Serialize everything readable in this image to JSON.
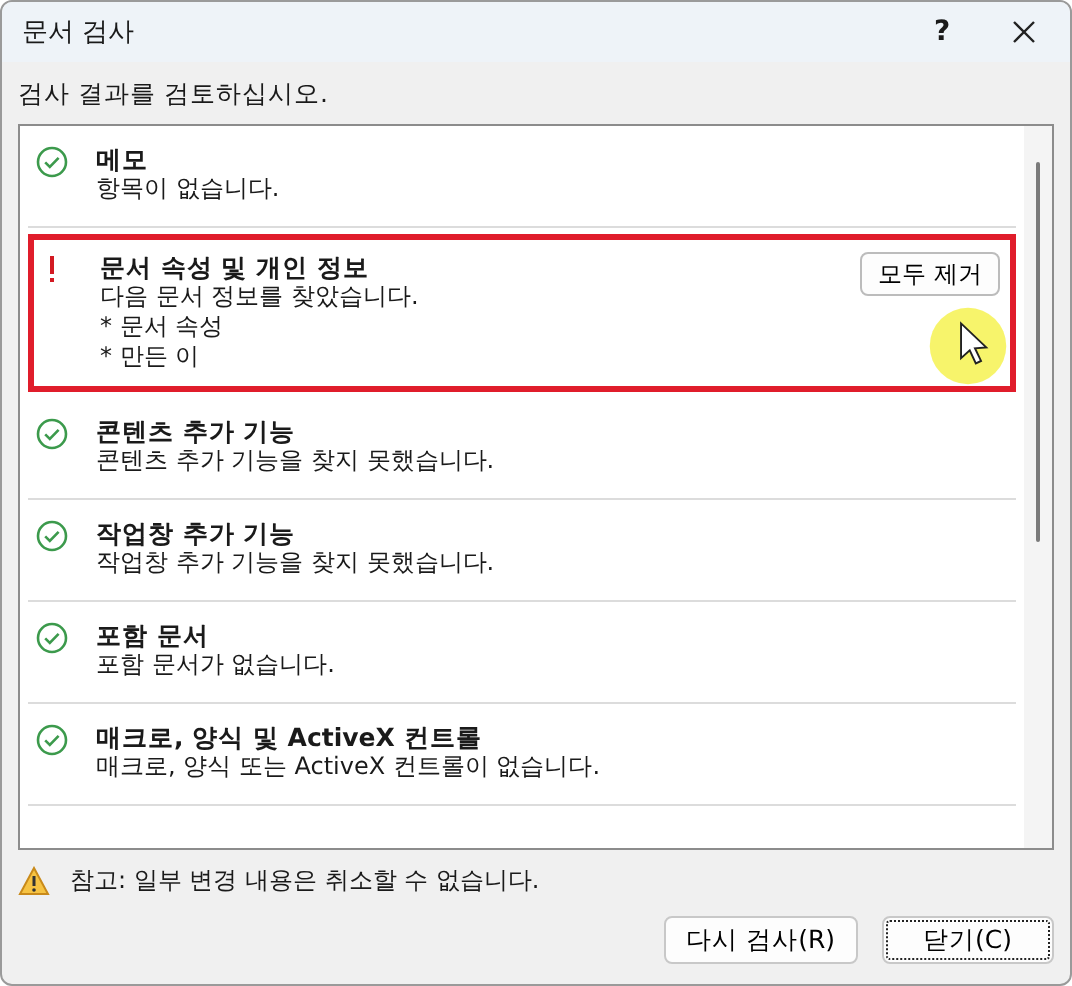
{
  "window": {
    "title": "문서 검사",
    "help": "?"
  },
  "instruction": "검사 결과를 검토하십시오.",
  "results": [
    {
      "kind": "ok",
      "title": "메모",
      "lines": [
        "항목이 없습니다."
      ]
    },
    {
      "kind": "issue",
      "title": "문서 속성 및 개인 정보",
      "lines": [
        "다음 문서 정보를 찾았습니다.",
        "* 문서 속성",
        "* 만든 이"
      ],
      "action": "모두 제거",
      "highlighted": true
    },
    {
      "kind": "ok",
      "title": "콘텐츠 추가 기능",
      "lines": [
        "콘텐츠 추가 기능을 찾지 못했습니다."
      ]
    },
    {
      "kind": "ok",
      "title": "작업창 추가 기능",
      "lines": [
        "작업창 추가 기능을 찾지 못했습니다."
      ]
    },
    {
      "kind": "ok",
      "title": "포함 문서",
      "lines": [
        "포함 문서가 없습니다."
      ]
    },
    {
      "kind": "ok",
      "title": "매크로, 양식 및 ActiveX 컨트롤",
      "lines": [
        "매크로, 양식 또는 ActiveX 컨트롤이 없습니다."
      ]
    }
  ],
  "note": "참고: 일부 변경 내용은 취소할 수 없습니다.",
  "buttons": [
    {
      "label": "다시 검사(R)",
      "focused": false
    },
    {
      "label": "닫기(C)",
      "focused": true
    }
  ]
}
